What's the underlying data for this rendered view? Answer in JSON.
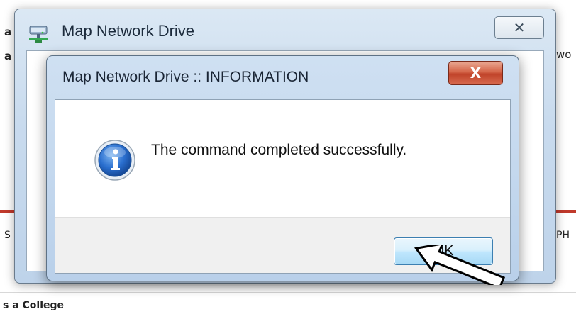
{
  "background": {
    "top_left_fragment": "a",
    "left_fragment": "a",
    "right_fragment": "wo",
    "bottom_left_fragment": "S",
    "bottom_right_fragment": "PH",
    "footer_text": "s a College",
    "redline_color": "#c0392b"
  },
  "outer_window": {
    "title": "Map Network Drive",
    "close_label": "✕",
    "icon": "network-drive-icon"
  },
  "dialog": {
    "title": "Map Network Drive :: INFORMATION",
    "close_label": "X",
    "message": "The command completed successfully.",
    "icon": "information-icon",
    "ok_label": "OK",
    "accent_color": "#3c7fb1"
  }
}
